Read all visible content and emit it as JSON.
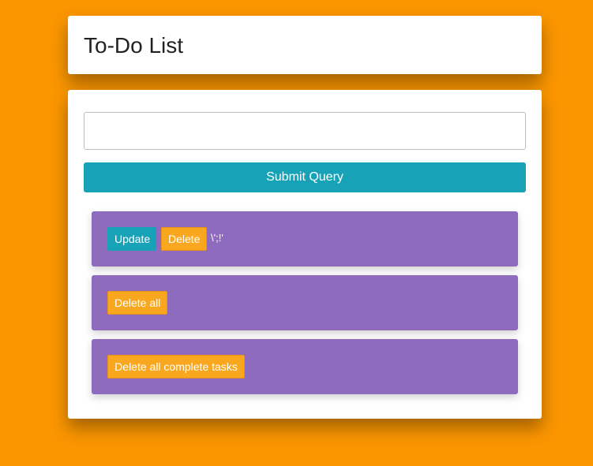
{
  "header": {
    "title": "To-Do List"
  },
  "form": {
    "input_value": "",
    "input_placeholder": "",
    "submit_label": "Submit Query"
  },
  "tasks": [
    {
      "text": "\\';!'",
      "update_label": "Update",
      "delete_label": "Delete"
    }
  ],
  "actions": {
    "delete_all_label": "Delete all",
    "delete_complete_label": "Delete all complete tasks"
  },
  "colors": {
    "background": "#fb9600",
    "panel": "#8f6bbe",
    "primary": "#17a2b8",
    "warning": "#f8a71e"
  }
}
